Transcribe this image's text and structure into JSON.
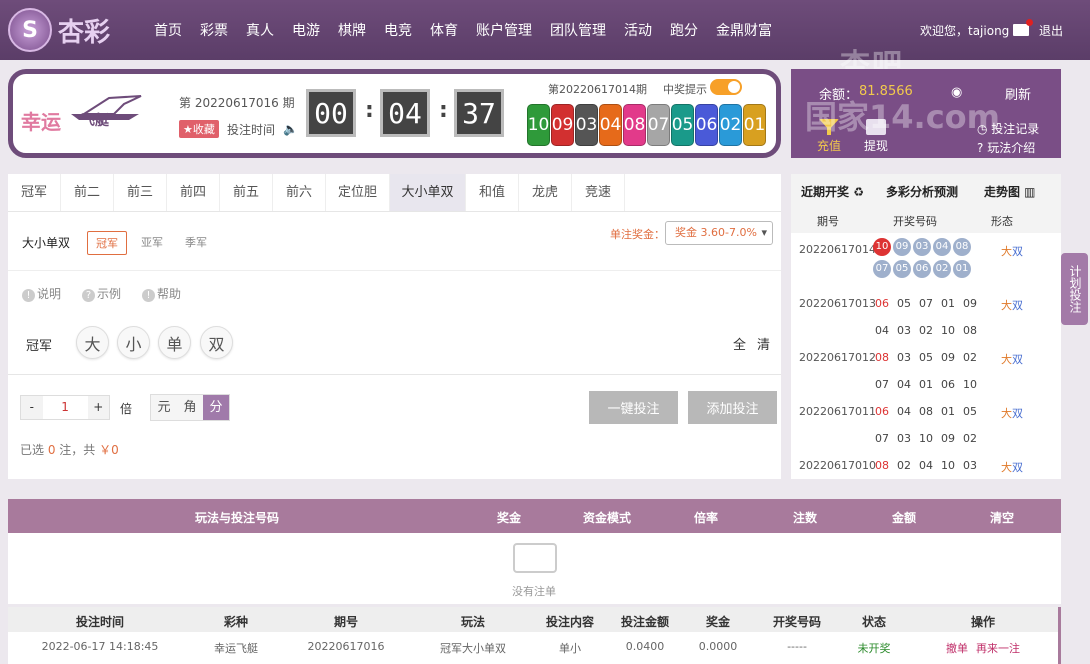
{
  "header": {
    "logo_text": "杏彩",
    "nav": [
      "首页",
      "彩票",
      "真人",
      "电游",
      "棋牌",
      "电竞",
      "体育",
      "账户管理",
      "团队管理",
      "活动",
      "跑分",
      "金鼎财富"
    ],
    "welcome": "欢迎您，tajiong",
    "logout": "退出"
  },
  "game": {
    "name": "幸运",
    "name2": "飞艇",
    "period_current": "第 20220617016 期",
    "favorite": "★收藏",
    "bet_time_label": "投注时间",
    "countdown": [
      "00",
      "04",
      "37"
    ],
    "last_period": "第20220617014期",
    "notify_label": "中奖提示",
    "notify_on": true,
    "balls": [
      {
        "n": "10",
        "color": "#2f9a3a"
      },
      {
        "n": "09",
        "color": "#d23030"
      },
      {
        "n": "03",
        "color": "#555555"
      },
      {
        "n": "04",
        "color": "#e66a1a"
      },
      {
        "n": "08",
        "color": "#e23a8a"
      },
      {
        "n": "07",
        "color": "#a6a6a6"
      },
      {
        "n": "05",
        "color": "#1a9a8a"
      },
      {
        "n": "06",
        "color": "#4a5ad8"
      },
      {
        "n": "02",
        "color": "#2a9ad8"
      },
      {
        "n": "01",
        "color": "#d8a020"
      }
    ]
  },
  "account": {
    "balance_label": "余额：",
    "balance": "81.8566",
    "refresh": "刷新",
    "deposit": "充值",
    "withdraw": "提现",
    "bet_record": "投注记录",
    "rules": "玩法介绍"
  },
  "watermark": [
    "杏吧",
    "国家14.com"
  ],
  "play": {
    "tabs": [
      "冠军",
      "前二",
      "前三",
      "前四",
      "前五",
      "前六",
      "定位胆",
      "大小单双",
      "和值",
      "龙虎",
      "竞速"
    ],
    "active_tab": 7,
    "sub_title": "大小单双",
    "subs": [
      "冠军",
      "亚军",
      "季军"
    ],
    "bonus_label": "单注奖金：",
    "bonus_value": "奖金 3.60-7.0%",
    "help": [
      "说明",
      "示例",
      "帮助"
    ],
    "position_label": "冠军",
    "options": [
      "大",
      "小",
      "单",
      "双"
    ],
    "all": "全",
    "clear": "清",
    "multiplier": "1",
    "mult_unit": "倍",
    "units": [
      "元",
      "角",
      "分"
    ],
    "active_unit": 2,
    "one_click": "一键投注",
    "add_bet": "添加投注",
    "summary_pre": "已选 ",
    "summary_count": "0",
    "summary_mid": " 注，共 ",
    "summary_amount": "￥0"
  },
  "history": {
    "tabs": [
      "近期开奖",
      "多彩分析预测",
      "走势图"
    ],
    "headers": [
      "期号",
      "开奖号码",
      "形态"
    ],
    "rows": [
      {
        "period": "20220617014",
        "nums": [
          "10",
          "09",
          "03",
          "04",
          "08",
          "07",
          "05",
          "06",
          "02",
          "01"
        ],
        "a": "大",
        "b": "双"
      },
      {
        "period": "20220617013",
        "nums": [
          "06",
          "05",
          "07",
          "01",
          "09",
          "04",
          "03",
          "02",
          "10",
          "08"
        ],
        "a": "大",
        "b": "双"
      },
      {
        "period": "20220617012",
        "nums": [
          "08",
          "03",
          "05",
          "09",
          "02",
          "07",
          "04",
          "01",
          "06",
          "10"
        ],
        "a": "大",
        "b": "双"
      },
      {
        "period": "20220617011",
        "nums": [
          "06",
          "04",
          "08",
          "01",
          "05",
          "07",
          "03",
          "10",
          "09",
          "02"
        ],
        "a": "大",
        "b": "双"
      },
      {
        "period": "20220617010",
        "nums": [
          "08",
          "02",
          "04",
          "10",
          "03"
        ],
        "a": "大",
        "b": "双"
      }
    ]
  },
  "plan_bet": "计划投注",
  "cart": {
    "headers": [
      "玩法与投注号码",
      "奖金",
      "资金模式",
      "倍率",
      "注数",
      "金额",
      "清空"
    ],
    "empty": "没有注单"
  },
  "records": {
    "headers": [
      "投注时间",
      "彩种",
      "期号",
      "玩法",
      "投注内容",
      "投注金额",
      "奖金",
      "开奖号码",
      "状态",
      "操作"
    ],
    "row": {
      "time": "2022-06-17 14:18:45",
      "lottery": "幸运飞艇",
      "period": "20220617016",
      "play": "冠军大小单双",
      "content": "单小",
      "amount": "0.0400",
      "bonus": "0.0000",
      "numbers": "-----",
      "status": "未开奖",
      "cancel": "撤单",
      "again": "再来一注"
    }
  }
}
